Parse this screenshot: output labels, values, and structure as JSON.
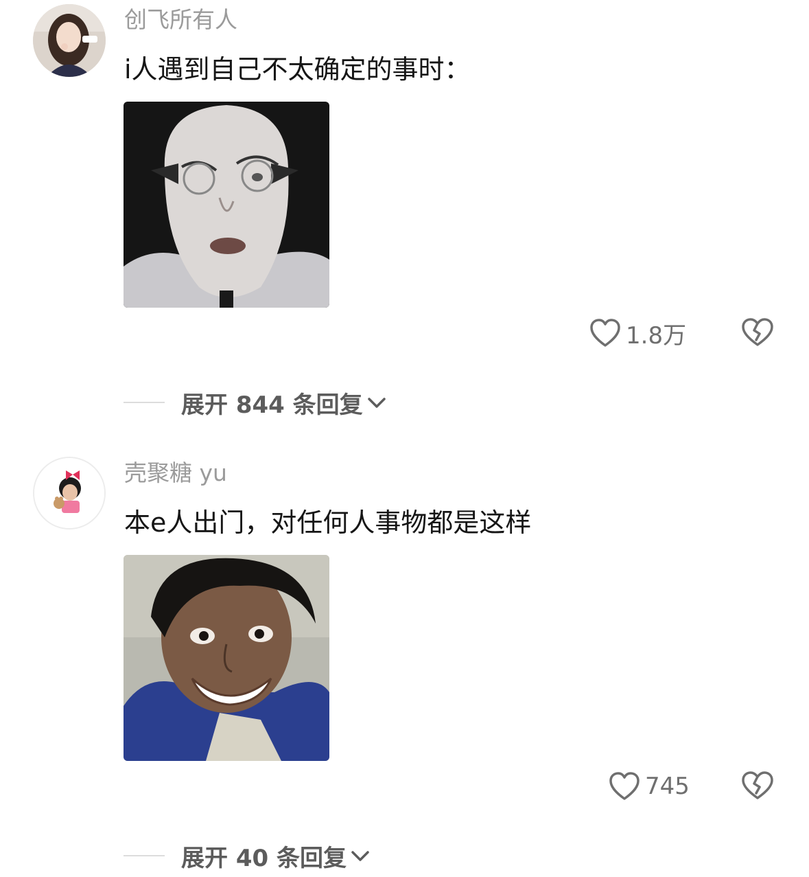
{
  "comments": [
    {
      "username": "创飞所有人",
      "text": "i人遇到自己不太确定的事时：",
      "likes": "1.8万",
      "expand_label": "展开 844 条回复"
    },
    {
      "username": "壳聚糖 yu",
      "text": "本e人出门，对任何人事物都是这样",
      "likes": "745",
      "expand_label": "展开 40 条回复"
    }
  ],
  "icons": {
    "like": "heart-outline-icon",
    "dislike": "broken-heart-icon",
    "expand": "chevron-down-icon"
  },
  "colors": {
    "username": "#9b9b9b",
    "text": "#161616",
    "meta": "#6f6f6f"
  }
}
